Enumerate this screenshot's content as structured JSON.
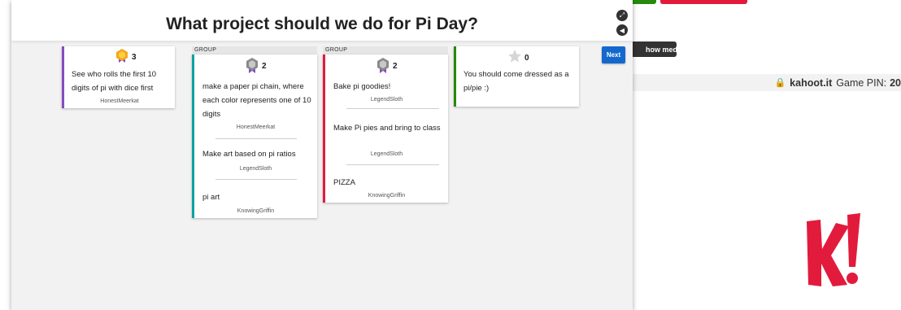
{
  "modal": {
    "title": "What project should we do for Pi Day?",
    "next_label": "Next"
  },
  "background": {
    "show_media_label": "how media",
    "pin_domain": "kahoot.it",
    "pin_label": "Game PIN:",
    "pin_value": "20"
  },
  "cards": [
    {
      "group_label": "",
      "badge": "gold-medal",
      "votes": "3",
      "accent": "#864cbf",
      "ideas": [
        {
          "text": "See who rolls the first 10 digits of pi with dice first",
          "author": "HonestMeerkat"
        }
      ]
    },
    {
      "group_label": "GROUP",
      "badge": "silver-medal",
      "votes": "2",
      "accent": "#0aa3a3",
      "ideas": [
        {
          "text": "make a paper pi chain, where each color represents one of 10 digits",
          "author": "HonestMeerkat"
        },
        {
          "text": "Make art based on pi ratios",
          "author": "LegendSloth"
        },
        {
          "text": "pi art",
          "author": "KnowingGriffin"
        }
      ]
    },
    {
      "group_label": "GROUP",
      "badge": "silver-medal",
      "votes": "2",
      "accent": "#e21b3c",
      "ideas": [
        {
          "text": "Bake pi goodies!",
          "author": "LegendSloth"
        },
        {
          "text": "Make Pi pies and bring to class",
          "author": "LegendSloth"
        },
        {
          "text": "PIZZA",
          "author": "KnowingGriffin"
        }
      ]
    },
    {
      "group_label": "",
      "badge": "star",
      "votes": "0",
      "accent": "#26890c",
      "ideas": [
        {
          "text": "You should come dressed as a pi/pie :)",
          "author": ""
        }
      ]
    }
  ],
  "colors": {
    "brand": "#e21b3c",
    "next_button": "#1368ce"
  }
}
